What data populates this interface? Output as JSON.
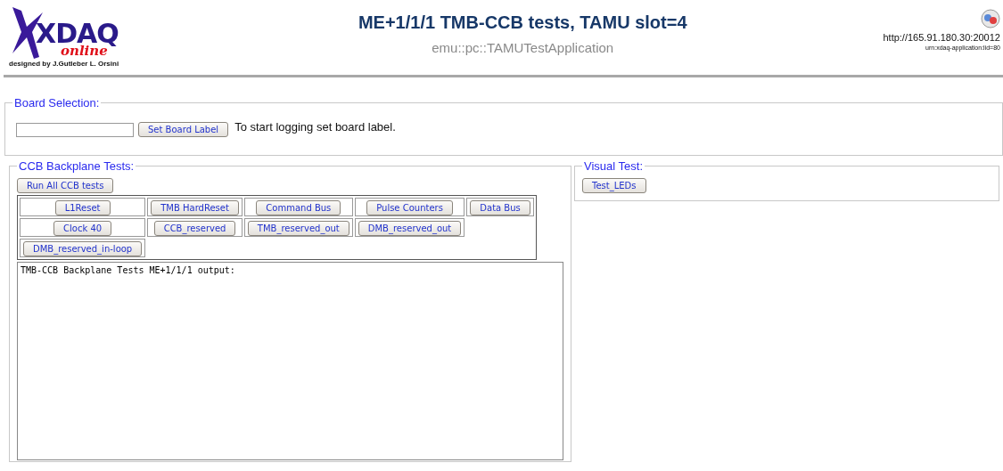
{
  "header": {
    "logo": {
      "word": "XDAQ",
      "tagline": "online",
      "credit": "designed by J.Gutleber L. Orsini"
    },
    "title": "ME+1/1/1 TMB-CCB tests, TAMU slot=4",
    "subtitle": "emu::pc::TAMUTestApplication",
    "url": "http://165.91.180.30:20012",
    "urn": "urn:xdaq-application:lid=80"
  },
  "board_selection": {
    "legend": "Board Selection:",
    "button": "Set Board Label",
    "note": "To start logging set board label."
  },
  "ccb_tests": {
    "legend": "CCB Backplane Tests:",
    "run_all": "Run All CCB tests",
    "rows": [
      [
        "L1Reset",
        "TMB HardReset",
        "Command Bus",
        "Pulse Counters",
        "Data Bus"
      ],
      [
        "Clock 40",
        "CCB_reserved",
        "TMB_reserved_out",
        "DMB_reserved_out"
      ],
      [
        "DMB_reserved_in-loop"
      ]
    ],
    "output": "TMB-CCB Backplane Tests ME+1/1/1 output:"
  },
  "visual_test": {
    "legend": "Visual Test:",
    "buttons": [
      "Test_LEDs"
    ]
  }
}
